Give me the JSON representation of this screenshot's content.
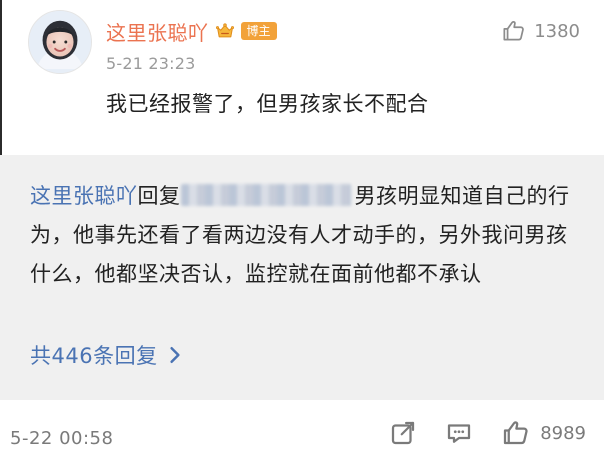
{
  "comment": {
    "username": "这里张聪吖",
    "badge": "博主",
    "timestamp": "5-21 23:23",
    "text": "我已经报警了，但男孩家长不配合",
    "likes": "1380",
    "icons": {
      "avatar": "avatar",
      "crown": "crown-icon",
      "like": "thumb-up-icon"
    }
  },
  "reply_box": {
    "reply_author": "这里张聪吖",
    "reply_verb": "回复",
    "reply_text": "男孩明显知道自己的行为，他事先还看了看两边没有人才动手的，另外我问男孩什么，他都坚决否认，监控就在面前他都不承认",
    "more_replies": "共446条回复",
    "icons": {
      "chevron": "chevron-right-icon"
    }
  },
  "bottom_bar": {
    "timestamp": "5-22 00:58",
    "likes": "8989",
    "icons": {
      "share": "share-icon",
      "comment": "comment-icon",
      "like": "thumb-up-icon"
    }
  },
  "colors": {
    "username": "#eb7350",
    "link_blue": "#4a73b3",
    "reply_bg": "#f0f0f0",
    "badge": "#f2a23a",
    "muted": "#8c8c8c"
  }
}
